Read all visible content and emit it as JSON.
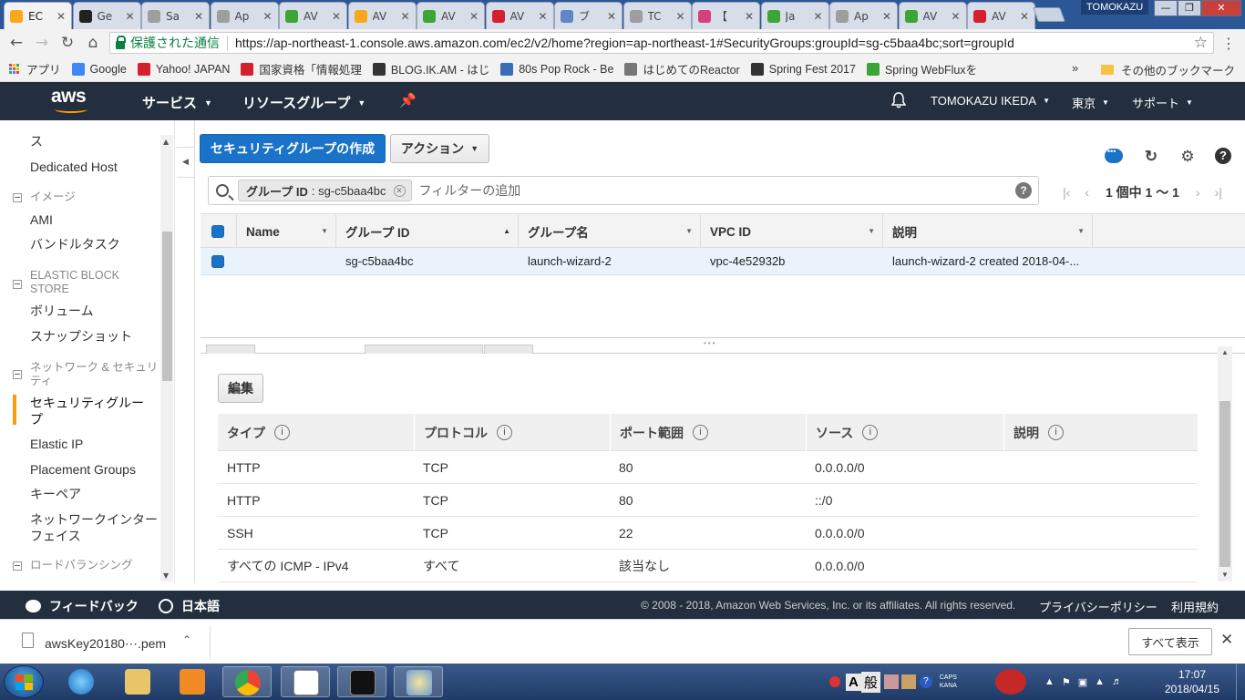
{
  "browser": {
    "tabs": [
      {
        "label": "EC",
        "fav_color": "#f7a81b"
      },
      {
        "label": "Ge",
        "fav_color": "#222222"
      },
      {
        "label": "Sa",
        "fav_color": "#9e9e9e"
      },
      {
        "label": "Ap",
        "fav_color": "#9e9e9e"
      },
      {
        "label": "AV",
        "fav_color": "#3ba635"
      },
      {
        "label": "AV",
        "fav_color": "#f7a81b"
      },
      {
        "label": "AV",
        "fav_color": "#3ba635"
      },
      {
        "label": "AV",
        "fav_color": "#d3202f"
      },
      {
        "label": "ブ",
        "fav_color": "#5f87c7"
      },
      {
        "label": "TC",
        "fav_color": "#9e9e9e"
      },
      {
        "label": "【",
        "fav_color": "#d5427b"
      },
      {
        "label": "Ja",
        "fav_color": "#3ba635"
      },
      {
        "label": "Ap",
        "fav_color": "#9e9e9e"
      },
      {
        "label": "AV",
        "fav_color": "#3ba635"
      },
      {
        "label": "AV",
        "fav_color": "#d3202f"
      }
    ],
    "window_user": "TOMOKAZU",
    "secure_label": "保護された通信",
    "url": "https://ap-northeast-1.console.aws.amazon.com/ec2/v2/home?region=ap-northeast-1#SecurityGroups:groupId=sg-c5baa4bc;sort=groupId",
    "bookmarks": [
      {
        "label": "アプリ"
      },
      {
        "label": "Google",
        "color": "#4285f4"
      },
      {
        "label": "Yahoo! JAPAN",
        "color": "#d3202f"
      },
      {
        "label": "国家資格「情報処理",
        "color": "#d3202f"
      },
      {
        "label": "BLOG.IK.AM - はじ",
        "color": "#333333"
      },
      {
        "label": "80s Pop Rock - Be",
        "color": "#3a6db5"
      },
      {
        "label": "はじめてのReactor",
        "color": "#777777"
      },
      {
        "label": "Spring Fest 2017",
        "color": "#333333"
      },
      {
        "label": "Spring WebFluxを",
        "color": "#3ba635"
      }
    ],
    "bookmarks_more": "»",
    "bookmarks_folder": "その他のブックマーク"
  },
  "aws_nav": {
    "logo_text": "aws",
    "services": "サービス",
    "resource_groups": "リソースグループ",
    "user": "TOMOKAZU IKEDA",
    "region": "東京",
    "support": "サポート"
  },
  "sidebar": {
    "items": [
      {
        "text": "ス",
        "type": "item"
      },
      {
        "text": "Dedicated Host",
        "type": "item"
      },
      {
        "text": "イメージ",
        "type": "section"
      },
      {
        "text": "AMI",
        "type": "item"
      },
      {
        "text": "バンドルタスク",
        "type": "item"
      },
      {
        "text": "ELASTIC BLOCK STORE",
        "type": "section"
      },
      {
        "text": "ボリューム",
        "type": "item"
      },
      {
        "text": "スナップショット",
        "type": "item"
      },
      {
        "text": "ネットワーク & セキュリティ",
        "type": "section"
      },
      {
        "text": "セキュリティグループ",
        "type": "active"
      },
      {
        "text": "Elastic IP",
        "type": "item"
      },
      {
        "text": "Placement Groups",
        "type": "item"
      },
      {
        "text": "キーペア",
        "type": "item"
      },
      {
        "text": "ネットワークインターフェイス",
        "type": "item"
      },
      {
        "text": "ロードバランシング",
        "type": "section"
      }
    ]
  },
  "toolbar": {
    "create_label": "セキュリティグループの作成",
    "action_label": "アクション"
  },
  "filter": {
    "token_key": "グループ ID",
    "token_value": ": sg-c5baa4bc",
    "placeholder": "フィルターの追加"
  },
  "pager": {
    "text": "1 個中 1 〜 1"
  },
  "grid": {
    "columns": [
      "Name",
      "グループ ID",
      "グループ名",
      "VPC ID",
      "説明"
    ],
    "rows": [
      {
        "name": "",
        "group_id": "sg-c5baa4bc",
        "group_name": "launch-wizard-2",
        "vpc_id": "vpc-4e52932b",
        "description": "launch-wizard-2 created 2018-04-..."
      }
    ]
  },
  "detail": {
    "edit_label": "編集",
    "columns": [
      "タイプ",
      "プロトコル",
      "ポート範囲",
      "ソース",
      "説明"
    ],
    "rules": [
      {
        "type": "HTTP",
        "protocol": "TCP",
        "port": "80",
        "source": "0.0.0.0/0",
        "desc": ""
      },
      {
        "type": "HTTP",
        "protocol": "TCP",
        "port": "80",
        "source": "::/0",
        "desc": ""
      },
      {
        "type": "SSH",
        "protocol": "TCP",
        "port": "22",
        "source": "0.0.0.0/0",
        "desc": ""
      },
      {
        "type": "すべての ICMP - IPv4",
        "protocol": "すべて",
        "port": "該当なし",
        "source": "0.0.0.0/0",
        "desc": ""
      }
    ]
  },
  "footer": {
    "feedback": "フィードバック",
    "language": "日本語",
    "copyright": "© 2008 - 2018, Amazon Web Services, Inc. or its affiliates. All rights reserved.",
    "privacy": "プライバシーポリシー",
    "terms": "利用規約"
  },
  "downloads": {
    "file": "awsKey20180⋯.pem",
    "show_all": "すべて表示"
  },
  "taskbar": {
    "ime_mode": "A",
    "ime_label": "般",
    "caps": "CAPS",
    "kana": "KANA",
    "time": "17:07",
    "date": "2018/04/15"
  }
}
